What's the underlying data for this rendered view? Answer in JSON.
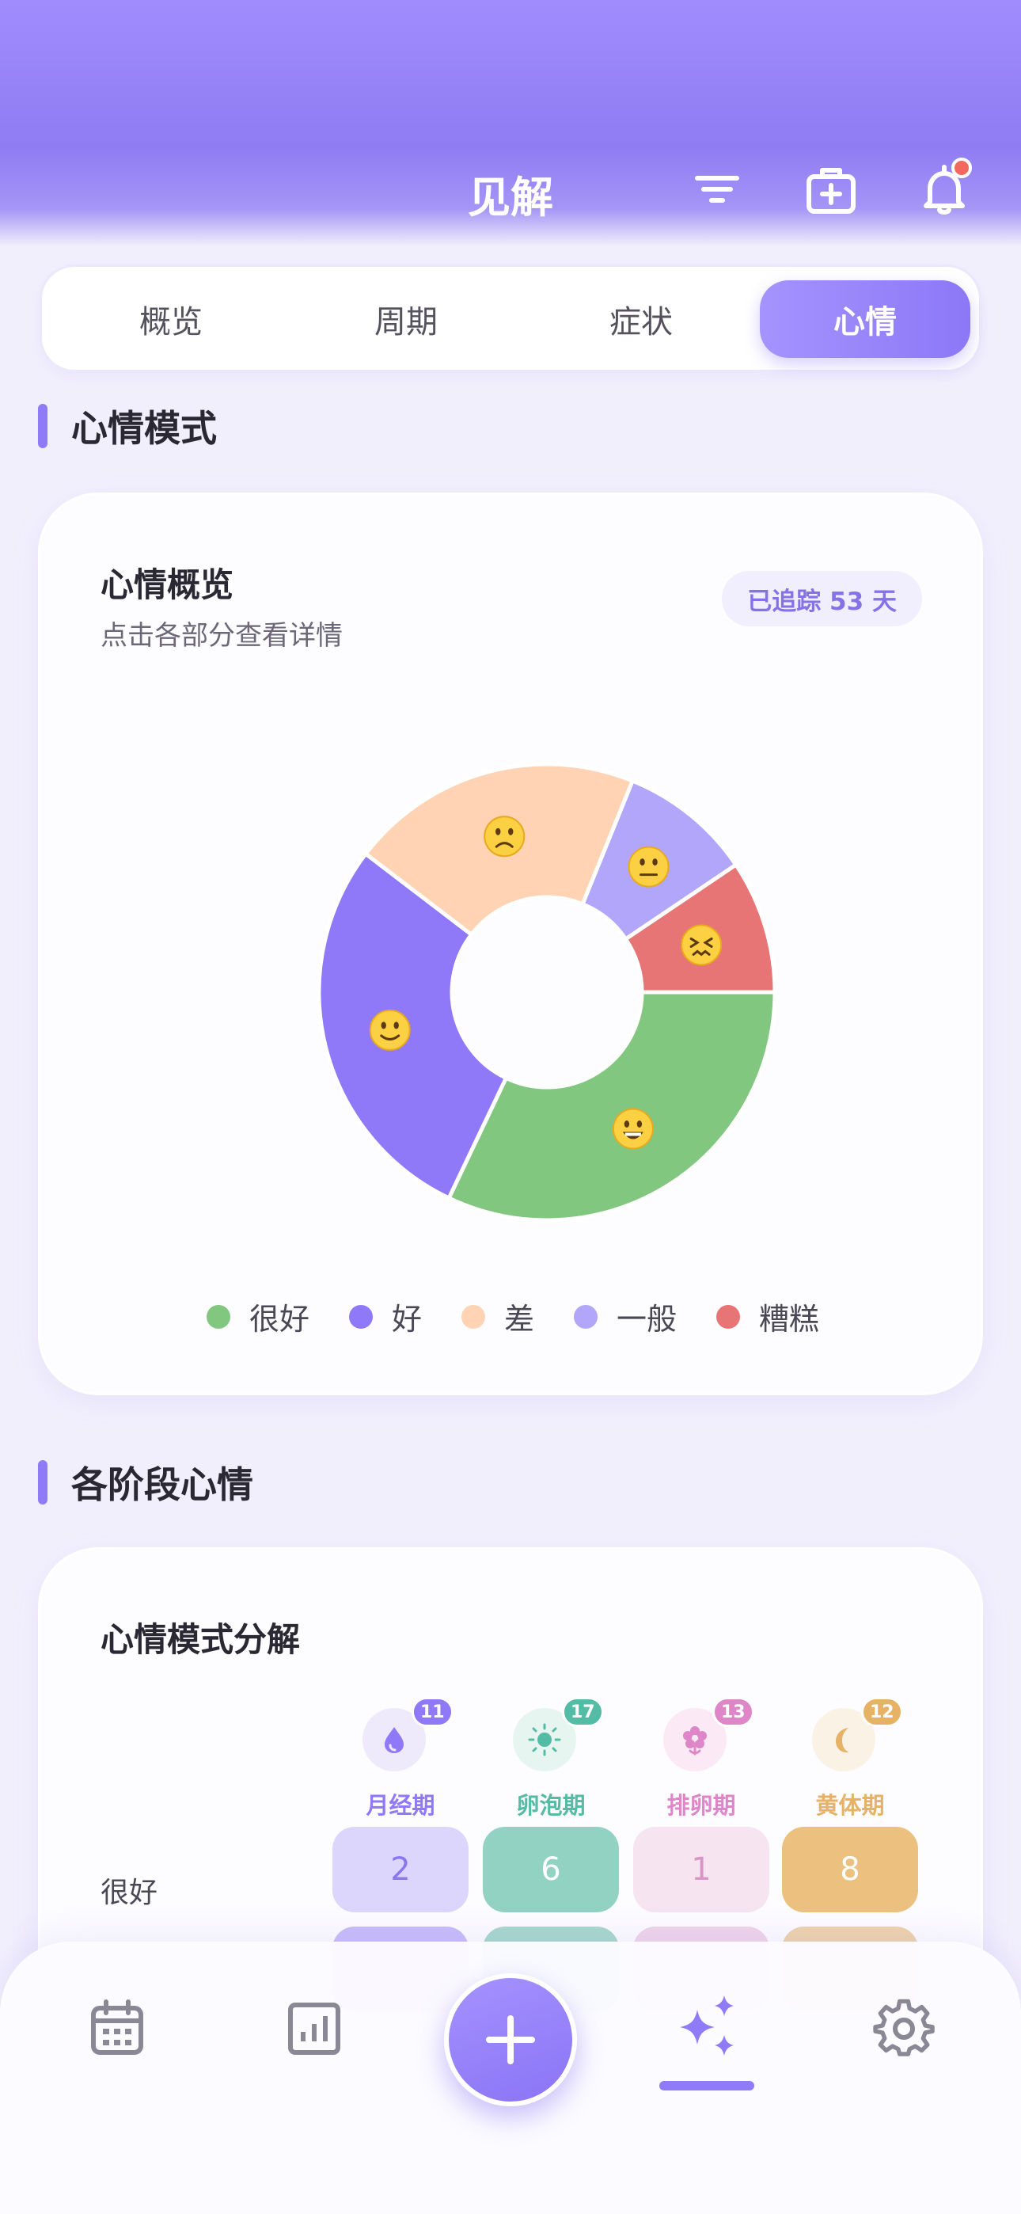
{
  "header": {
    "title": "见解"
  },
  "tabs": [
    {
      "label": "概览",
      "active": false
    },
    {
      "label": "周期",
      "active": false
    },
    {
      "label": "症状",
      "active": false
    },
    {
      "label": "心情",
      "active": true
    }
  ],
  "sections": {
    "mood_patterns": "心情模式",
    "phase_moods": "各阶段心情"
  },
  "overview_card": {
    "title": "心情概览",
    "subtitle": "点击各部分查看详情",
    "badge": "已追踪 53 天"
  },
  "chart_data": {
    "type": "pie",
    "categories": [
      "很好",
      "好",
      "差",
      "一般",
      "糟糕"
    ],
    "values": [
      17,
      15,
      11,
      5,
      5
    ],
    "colors": [
      "#82c77f",
      "#8f79f8",
      "#ffd3b4",
      "#b2a6fb",
      "#e77575"
    ],
    "icons": [
      "grinning-face-icon",
      "slightly-smiling-face-icon",
      "frowning-face-icon",
      "neutral-face-icon",
      "confounded-face-icon"
    ],
    "legend": {
      "position": "bottom"
    }
  },
  "breakdown_card": {
    "title": "心情模式分解",
    "phases": [
      {
        "label": "月经期",
        "count": "11",
        "color": "#8f79f8",
        "icon_bg": "#eeeafc",
        "icon": "droplet-icon"
      },
      {
        "label": "卵泡期",
        "count": "17",
        "color": "#54bba5",
        "icon_bg": "#e7f5f1",
        "icon": "sun-icon"
      },
      {
        "label": "排卵期",
        "count": "13",
        "color": "#de86c8",
        "icon_bg": "#fbeaf5",
        "icon": "flower-icon"
      },
      {
        "label": "黄体期",
        "count": "12",
        "color": "#e6b266",
        "icon_bg": "#fbf2e6",
        "icon": "moon-icon"
      }
    ],
    "rows": [
      {
        "label": "很好",
        "values": [
          "2",
          "6",
          "1",
          "8"
        ]
      }
    ]
  },
  "nav": {
    "items": [
      "calendar-icon",
      "chart-icon",
      "add-icon",
      "sparkles-icon",
      "gear-icon"
    ],
    "active": "sparkles-icon"
  }
}
